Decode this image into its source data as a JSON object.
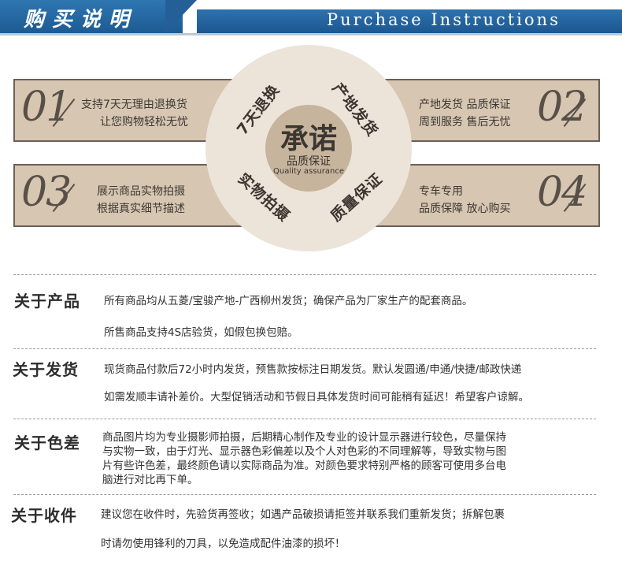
{
  "header": {
    "title_cn": "购买说明",
    "title_en": "Purchase Instructions",
    "colors": {
      "primary": "#1f5e97",
      "rule": "#b9c9d8"
    }
  },
  "promises": [
    {
      "number": "01",
      "line1": "支持7天无理由退换货",
      "line2": "让您购物轻松无忧"
    },
    {
      "number": "02",
      "line1": "产地发货 品质保证",
      "line2": "周到服务 售后无忧"
    },
    {
      "number": "03",
      "line1": "展示商品实物拍摄",
      "line2": "根据真实细节描述"
    },
    {
      "number": "04",
      "line1": "专车专用",
      "line2": "品质保障 放心购买"
    }
  ],
  "circle": {
    "main": "承诺",
    "sub": "品质保证",
    "en": "Quality assurance",
    "words": [
      "7天退换",
      "产地发货",
      "实物拍摄",
      "质量保证"
    ],
    "colors": {
      "outer": "#ece4d9",
      "inner": "#c7b49c",
      "panel": "#d6c6b2"
    }
  },
  "sections": [
    {
      "title": "关于产品",
      "lines": [
        "所有商品均从五菱/宝骏产地-广西柳州发货；确保产品为厂家生产的配套商品。",
        "所售商品支持4S店验货，如假包换包赔。"
      ]
    },
    {
      "title": "关于发货",
      "lines": [
        "现货商品付款后72小时内发货，预售款按标注日期发货。默认发圆通/申通/快捷/邮政快递",
        "如需发顺丰请补差价。大型促销活动和节假日具体发货时间可能稍有延迟！希望客户谅解。"
      ]
    },
    {
      "title": "关于色差",
      "lines": [
        "商品图片均为专业摄影师拍摄，后期精心制作及专业的设计显示器进行较色，尽量保持",
        "与实物一致，由于灯光、显示器色彩偏差以及个人对色彩的不同理解等，导致实物与图",
        "片有些许色差，最终颜色请以实际商品为准。对颜色要求特别严格的顾客可使用多台电",
        "脑进行对比再下单。"
      ]
    },
    {
      "title": "关于收件",
      "lines": [
        "建议您在收件时，先验货再签收；如遇产品破损请拒签并联系我们重新发货；拆解包裹",
        "时请勿使用锋利的刀具，以免造成配件油漆的损坏！"
      ]
    }
  ]
}
